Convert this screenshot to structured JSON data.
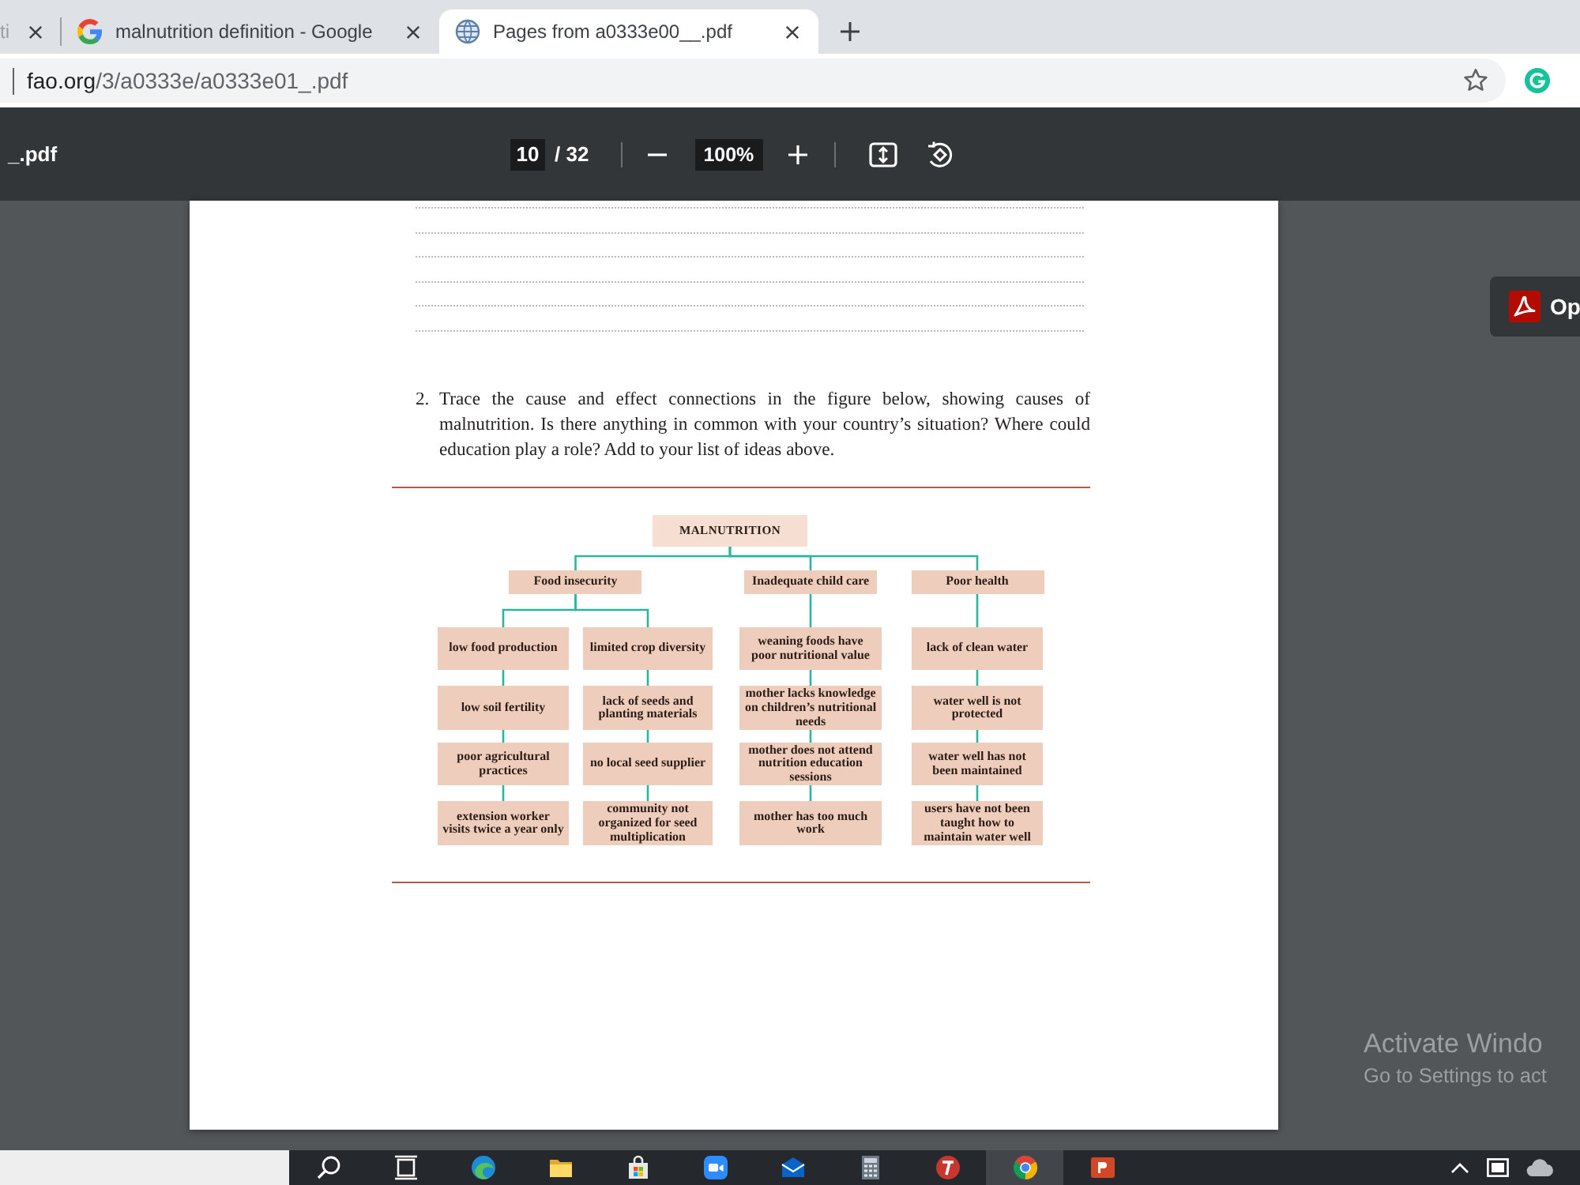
{
  "tabs": [
    {
      "title": "ti",
      "selected": false
    },
    {
      "title": "malnutrition definition - Google",
      "selected": false
    },
    {
      "title": "Pages from a0333e00__.pdf",
      "selected": true
    }
  ],
  "address_bar": {
    "host": "fao.org",
    "path": "/3/a0333e/a0333e01_.pdf"
  },
  "pdf_toolbar": {
    "title": "_.pdf",
    "page": "10",
    "page_count": "/ 32",
    "zoom": "100%"
  },
  "open_button": {
    "label": "Op"
  },
  "document": {
    "question": {
      "number": "2.",
      "text": "Trace the cause and effect connections in the figure below, showing causes of malnutrition. Is there anything in common with your country’s situation? Where could education play a role? Add to your list of ideas above."
    },
    "figure": {
      "root": {
        "label": "MALNUTRITION",
        "children": [
          {
            "label": "Food insecurity",
            "children": [
              {
                "label": "low food production",
                "children": [
                  {
                    "label": "low soil fertility",
                    "children": [
                      {
                        "label": "poor agricultural practices",
                        "children": [
                          {
                            "label": "extension worker visits twice a year only"
                          }
                        ]
                      }
                    ]
                  }
                ]
              },
              {
                "label": "limited crop diversity",
                "children": [
                  {
                    "label": "lack of seeds and planting materials",
                    "children": [
                      {
                        "label": "no local seed supplier",
                        "children": [
                          {
                            "label": "community not organized for seed multiplication"
                          }
                        ]
                      }
                    ]
                  }
                ]
              }
            ]
          },
          {
            "label": "Inadequate child care",
            "children": [
              {
                "label": "weaning foods have poor nutritional value",
                "children": [
                  {
                    "label": "mother lacks knowledge on children’s nutritional needs",
                    "children": [
                      {
                        "label": "mother does not attend nutrition education sessions",
                        "children": [
                          {
                            "label": "mother has too much work"
                          }
                        ]
                      }
                    ]
                  }
                ]
              }
            ]
          },
          {
            "label": "Poor health",
            "children": [
              {
                "label": "lack of clean water",
                "children": [
                  {
                    "label": "water well is not protected",
                    "children": [
                      {
                        "label": "water well has not been maintained",
                        "children": [
                          {
                            "label": "users have not been taught how to maintain water well"
                          }
                        ]
                      }
                    ]
                  }
                ]
              }
            ]
          }
        ]
      }
    }
  },
  "activation_notice": {
    "title": "Activate Windo",
    "subtitle": "Go to Settings to act"
  },
  "taskbar": {
    "apps": [
      {
        "active": false
      },
      {
        "active": false
      },
      {
        "active": false
      },
      {
        "active": false
      },
      {
        "active": false
      },
      {
        "active": false
      },
      {
        "active": false
      },
      {
        "active": true
      },
      {
        "active": false
      }
    ]
  }
}
